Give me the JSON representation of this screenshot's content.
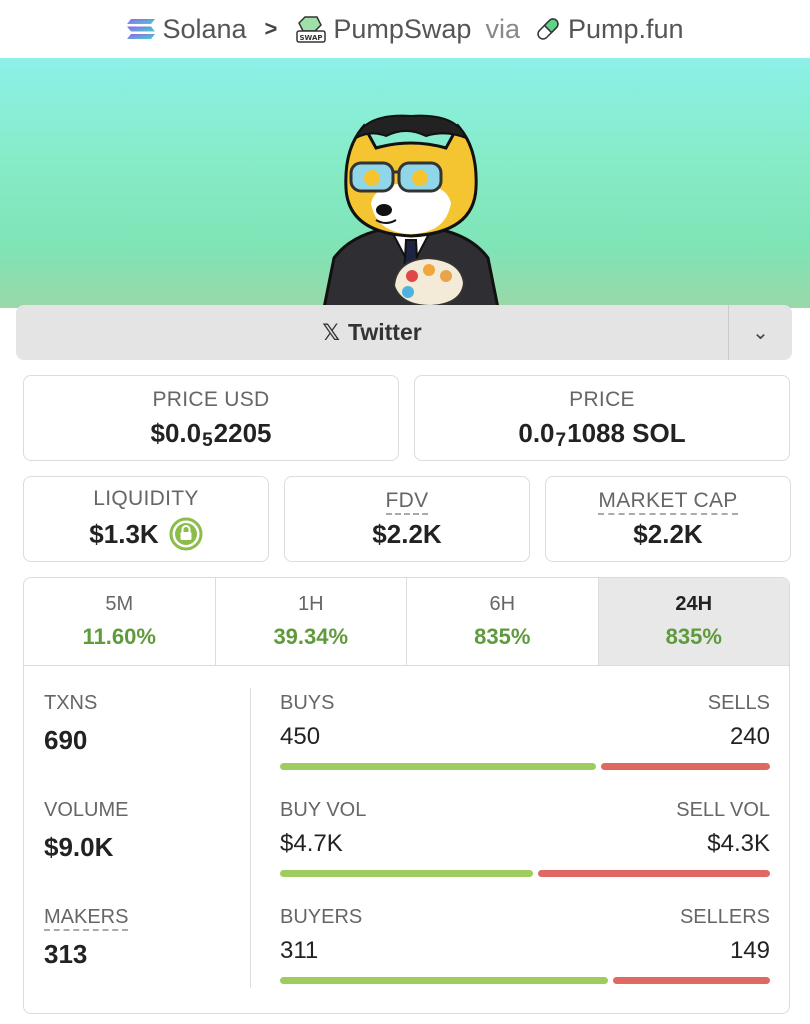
{
  "breadcrumb": {
    "chain": "Solana",
    "dex": "PumpSwap",
    "via_label": "via",
    "launchpad": "Pump.fun",
    "dex_icon_text": "SWAP"
  },
  "social": {
    "label": "Twitter",
    "icon": "x-icon",
    "x_glyph": "𝕏",
    "toggle_glyph": "⌄"
  },
  "price_usd": {
    "label": "PRICE USD",
    "prefix": "$0.0",
    "zeros": "5",
    "digits": "2205"
  },
  "price_native": {
    "label": "PRICE",
    "prefix": "0.0",
    "zeros": "7",
    "digits": "1088 SOL"
  },
  "liquidity": {
    "label": "LIQUIDITY",
    "value": "$1.3K",
    "icon": "lock-icon"
  },
  "fdv": {
    "label": "FDV",
    "value": "$2.2K"
  },
  "market_cap": {
    "label": "MARKET CAP",
    "value": "$2.2K"
  },
  "tabs": [
    {
      "label": "5M",
      "change": "11.60%"
    },
    {
      "label": "1H",
      "change": "39.34%"
    },
    {
      "label": "6H",
      "change": "835%"
    },
    {
      "label": "24H",
      "change": "835%",
      "selected": true
    }
  ],
  "txns": {
    "label": "TXNS",
    "value": "690",
    "buys_label": "BUYS",
    "buys": "450",
    "sells_label": "SELLS",
    "sells": "240",
    "buy_fraction": 0.652
  },
  "volume": {
    "label": "VOLUME",
    "value": "$9.0K",
    "buy_label": "BUY VOL",
    "buy": "$4.7K",
    "sell_label": "SELL VOL",
    "sell": "$4.3K",
    "buy_fraction": 0.522
  },
  "makers": {
    "label": "MAKERS",
    "value": "313",
    "buyers_label": "BUYERS",
    "buyers": "311",
    "sellers_label": "SELLERS",
    "sellers": "149",
    "buy_fraction": 0.676
  },
  "colors": {
    "positive": "#5f9a3c",
    "buy_bar": "#9fcc5e",
    "sell_bar": "#e06862",
    "banner_start": "#8cf0e8",
    "banner_end": "#9ad8a8"
  }
}
